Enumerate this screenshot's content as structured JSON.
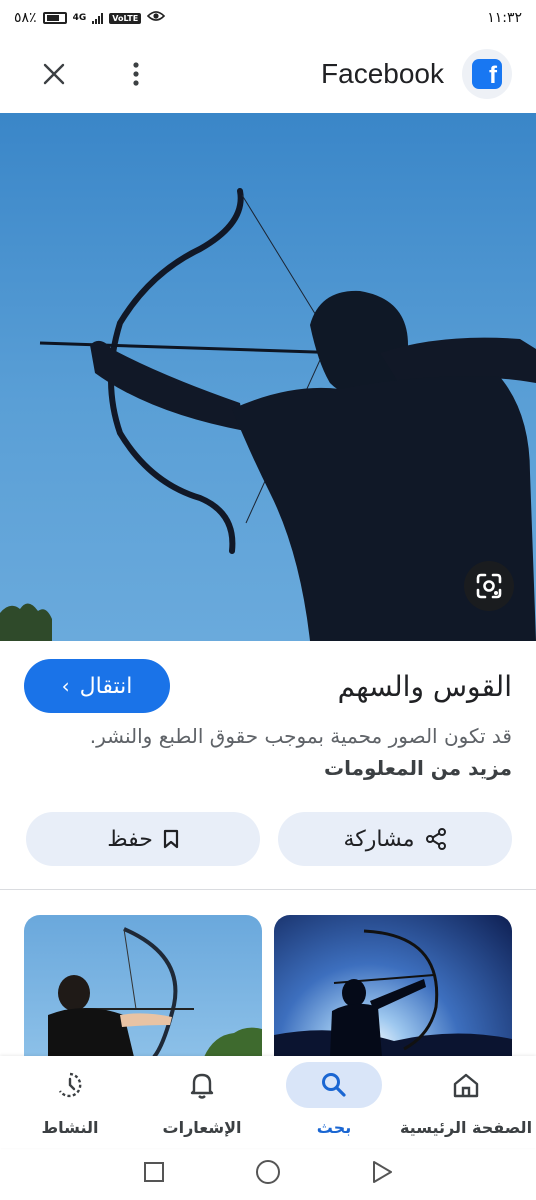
{
  "status_bar": {
    "time": "١١:٣٢",
    "battery": "٥٨٪",
    "network": "4G",
    "volte": "VoLTE"
  },
  "header": {
    "site_name": "Facebook",
    "close_icon": "close-icon",
    "menu_icon": "more-vert-icon",
    "logo_icon": "facebook-logo-icon",
    "logo_letter": "f"
  },
  "image_viewer": {
    "lens_icon": "google-lens-icon"
  },
  "result": {
    "title": "القوس والسهم",
    "visit_label": "انتقال",
    "copyright_text": "قد تكون الصور محمية بموجب حقوق الطبع والنشر.",
    "more_info_label": "مزيد من المعلومات"
  },
  "actions": {
    "share_label": "مشاركة",
    "save_label": "حفظ"
  },
  "bottom_nav": {
    "items": [
      {
        "label": "الصفحة الرئيسية",
        "icon": "home-icon",
        "active": false
      },
      {
        "label": "بحث",
        "icon": "search-icon",
        "active": true
      },
      {
        "label": "الإشعارات",
        "icon": "bell-icon",
        "active": false
      },
      {
        "label": "النشاط",
        "icon": "activity-history-icon",
        "active": false
      }
    ]
  },
  "colors": {
    "accent": "#1a73e8",
    "chip_bg": "#e8eef8",
    "facebook_blue": "#1877f2",
    "sky": "#4a93d0"
  }
}
